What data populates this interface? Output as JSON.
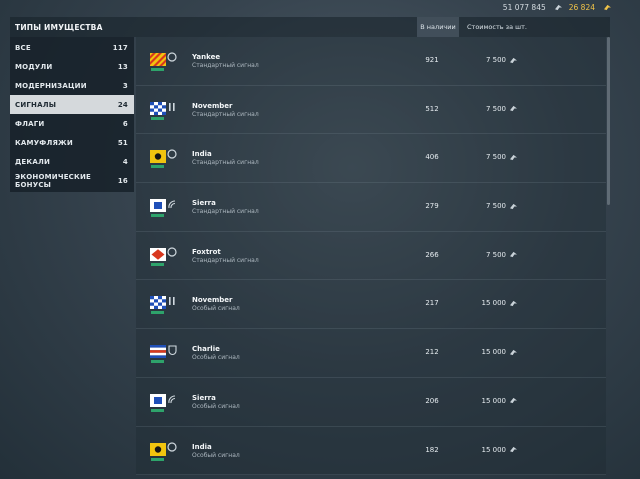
{
  "topbar": {
    "credits": "51 077 845",
    "gold": "26 824"
  },
  "colors": {
    "active_bg": "#d5d9dc",
    "gold": "#f0c348",
    "panel": "#16202a"
  },
  "sidebar": {
    "title": "ТИПЫ ИМУЩЕСТВА",
    "items": [
      {
        "label": "ВСЕ",
        "count": "117"
      },
      {
        "label": "МОДУЛИ",
        "count": "13"
      },
      {
        "label": "МОДЕРНИЗАЦИИ",
        "count": "3"
      },
      {
        "label": "СИГНАЛЫ",
        "count": "24"
      },
      {
        "label": "ФЛАГИ",
        "count": "6"
      },
      {
        "label": "КАМУФЛЯЖИ",
        "count": "51"
      },
      {
        "label": "ДЕКАЛИ",
        "count": "4"
      },
      {
        "label": "ЭКОНОМИЧЕСКИЕ БОНУСЫ",
        "count": "16"
      }
    ]
  },
  "columns": {
    "stock": "В наличии",
    "price": "Стоимость за шт."
  },
  "items": [
    {
      "name": "Yankee",
      "desc": "Стандартный сигнал",
      "stock": "921",
      "price": "7 500",
      "icon": "yankee-flag-icon"
    },
    {
      "name": "November",
      "desc": "Стандартный сигнал",
      "stock": "512",
      "price": "7 500",
      "icon": "november-flag-icon"
    },
    {
      "name": "India",
      "desc": "Стандартный сигнал",
      "stock": "406",
      "price": "7 500",
      "icon": "india-flag-icon"
    },
    {
      "name": "Sierra",
      "desc": "Стандартный сигнал",
      "stock": "279",
      "price": "7 500",
      "icon": "sierra-flag-icon"
    },
    {
      "name": "Foxtrot",
      "desc": "Стандартный сигнал",
      "stock": "266",
      "price": "7 500",
      "icon": "foxtrot-flag-icon"
    },
    {
      "name": "November",
      "desc": "Особый сигнал",
      "stock": "217",
      "price": "15 000",
      "icon": "november-flag-icon"
    },
    {
      "name": "Charlie",
      "desc": "Особый сигнал",
      "stock": "212",
      "price": "15 000",
      "icon": "charlie-flag-icon"
    },
    {
      "name": "Sierra",
      "desc": "Особый сигнал",
      "stock": "206",
      "price": "15 000",
      "icon": "sierra-flag-icon"
    },
    {
      "name": "India",
      "desc": "Особый сигнал",
      "stock": "182",
      "price": "15 000",
      "icon": "india-flag-icon"
    }
  ]
}
